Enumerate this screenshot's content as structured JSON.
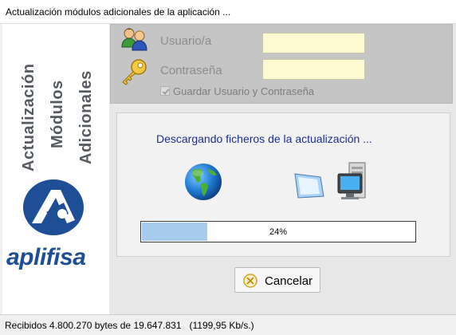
{
  "window": {
    "title": "Actualización módulos adicionales de la aplicación ..."
  },
  "sidebar": {
    "line1": "Actualización",
    "line2": "Módulos",
    "line3": "Adicionales",
    "brand": "aplifisa",
    "brand_color": "#1e4e96"
  },
  "login": {
    "user_label": "Usuario/a",
    "user_value": "",
    "password_label": "Contraseña",
    "password_value": "",
    "remember_label": "Guardar Usuario y Contraseña",
    "remember_checked": true,
    "users_icon": "users-icon",
    "key_icon": "key-icon"
  },
  "download": {
    "message": "Descargando ficheros de la actualización ...",
    "progress_fraction": 0.24,
    "progress_label": "24%",
    "globe_icon": "globe-icon",
    "transfer_icon": "transfer-icon"
  },
  "actions": {
    "cancel_label": "Cancelar",
    "cancel_icon": "cancel-icon"
  },
  "status": {
    "text": "Recibidos 4.800.270 bytes de 19.647.831   (1199,95 Kb/s.)"
  }
}
